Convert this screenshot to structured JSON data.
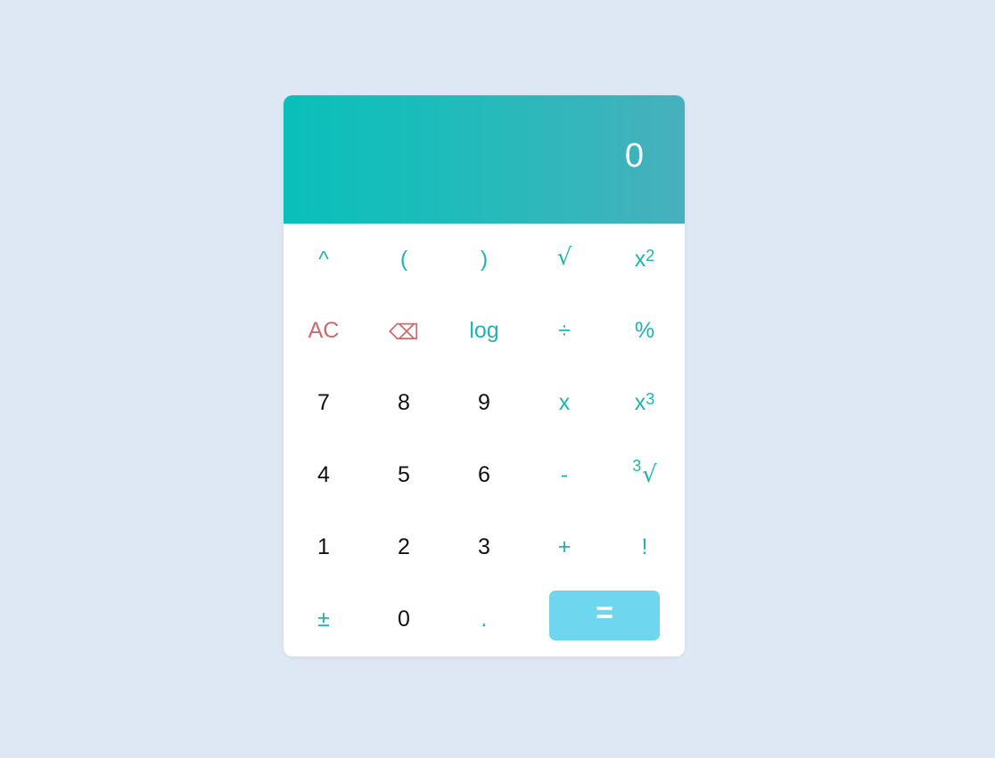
{
  "display": {
    "value": "0"
  },
  "keys": {
    "power": "^",
    "paren_open": "(",
    "paren_close": ")",
    "sqrt": "√",
    "square_base": "x",
    "square_exp": "2",
    "clear": "AC",
    "backspace": "⌫",
    "log": "log",
    "divide": "÷",
    "percent": "%",
    "seven": "7",
    "eight": "8",
    "nine": "9",
    "multiply": "x",
    "cube_base": "x",
    "cube_exp": "3",
    "four": "4",
    "five": "5",
    "six": "6",
    "subtract": "-",
    "cbrt_index": "3",
    "cbrt_symbol": "√",
    "one": "1",
    "two": "2",
    "three": "3",
    "add": "+",
    "factorial": "!",
    "plus_minus": "±",
    "zero": "0",
    "decimal": ".",
    "equals": "="
  },
  "colors": {
    "accent": "#1cb5b4",
    "danger": "#d06a6a",
    "equals_bg": "#6ed6ee",
    "background": "#dee8f4"
  }
}
